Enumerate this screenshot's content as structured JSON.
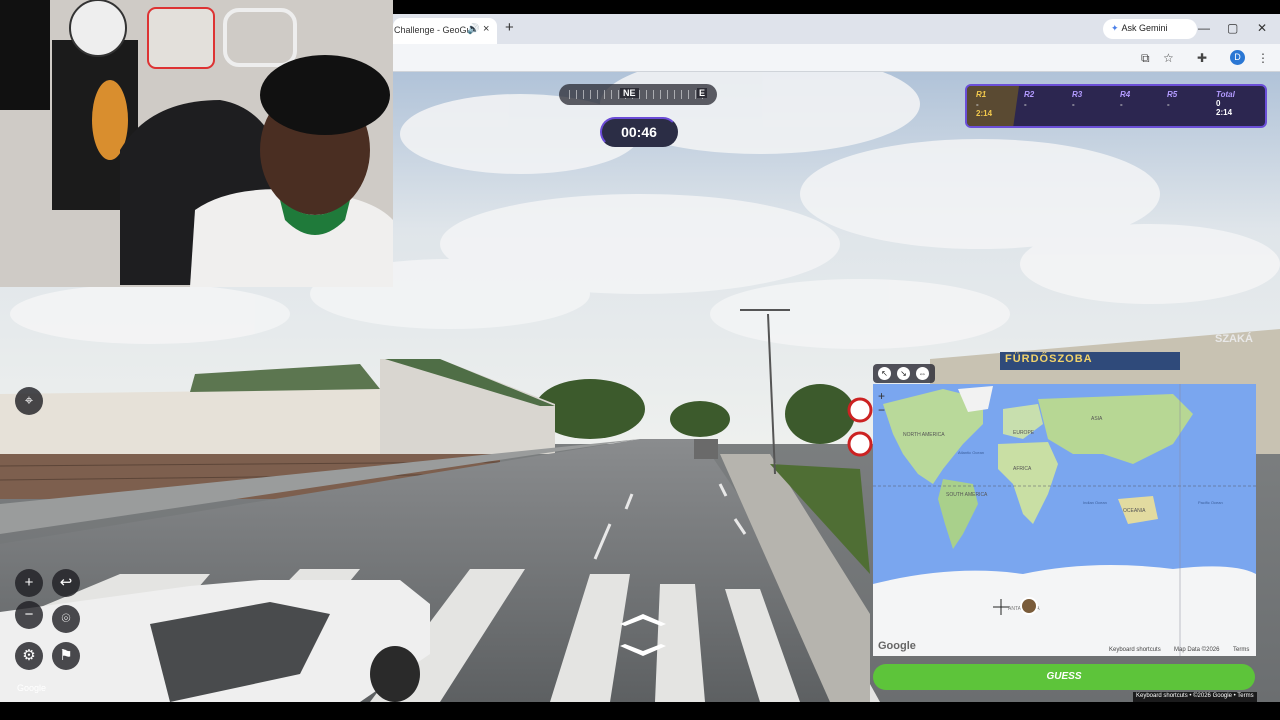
{
  "browser": {
    "tab_title": "Challenge - GeoGu",
    "tab_audio_icon": "speaker-icon",
    "tab_close": "×",
    "new_tab": "+",
    "gemini_label": "Ask Gemini",
    "avatar_letter": "D",
    "window_controls": [
      "—",
      "▢",
      "✕"
    ]
  },
  "compass": {
    "primary": "NE",
    "secondary": "E"
  },
  "timer": "00:46",
  "scoreboard": {
    "rounds": [
      {
        "label": "R1",
        "line1": "-",
        "line2": "2:14"
      },
      {
        "label": "R2",
        "line1": "-",
        "line2": ""
      },
      {
        "label": "R3",
        "line1": "-",
        "line2": ""
      },
      {
        "label": "R4",
        "line1": "-",
        "line2": ""
      },
      {
        "label": "R5",
        "line1": "-",
        "line2": ""
      }
    ],
    "total": {
      "label": "Total",
      "line1": "0",
      "line2": "2:14"
    }
  },
  "streetview": {
    "google_logo": "Google",
    "controls": [
      "zoom-in",
      "undo",
      "zoom-out",
      "return-to-start",
      "settings",
      "flag"
    ]
  },
  "map": {
    "labels": {
      "north_america": "NORTH AMERICA",
      "south_america": "SOUTH AMERICA",
      "europe": "EUROPE",
      "africa": "AFRICA",
      "asia": "ASIA",
      "oceania": "OCEANIA",
      "atlantic": "Atlantic Ocean",
      "indian": "Indian Ocean",
      "pacific": "Pacific Ocean",
      "antarctica": "ANTARCTICA"
    },
    "google_logo": "Google",
    "footer": {
      "shortcuts": "Keyboard shortcuts",
      "map_data": "Map Data ©2026",
      "terms": "Terms"
    },
    "zoom_in": "+",
    "zoom_out": "−"
  },
  "guess_button": "GUESS",
  "bottom_credits": "Keyboard shortcuts  •  ©2026 Google  •  Terms",
  "storefront_signs": [
    "FÜRDŐSZOBA",
    "SZAKÁ"
  ]
}
